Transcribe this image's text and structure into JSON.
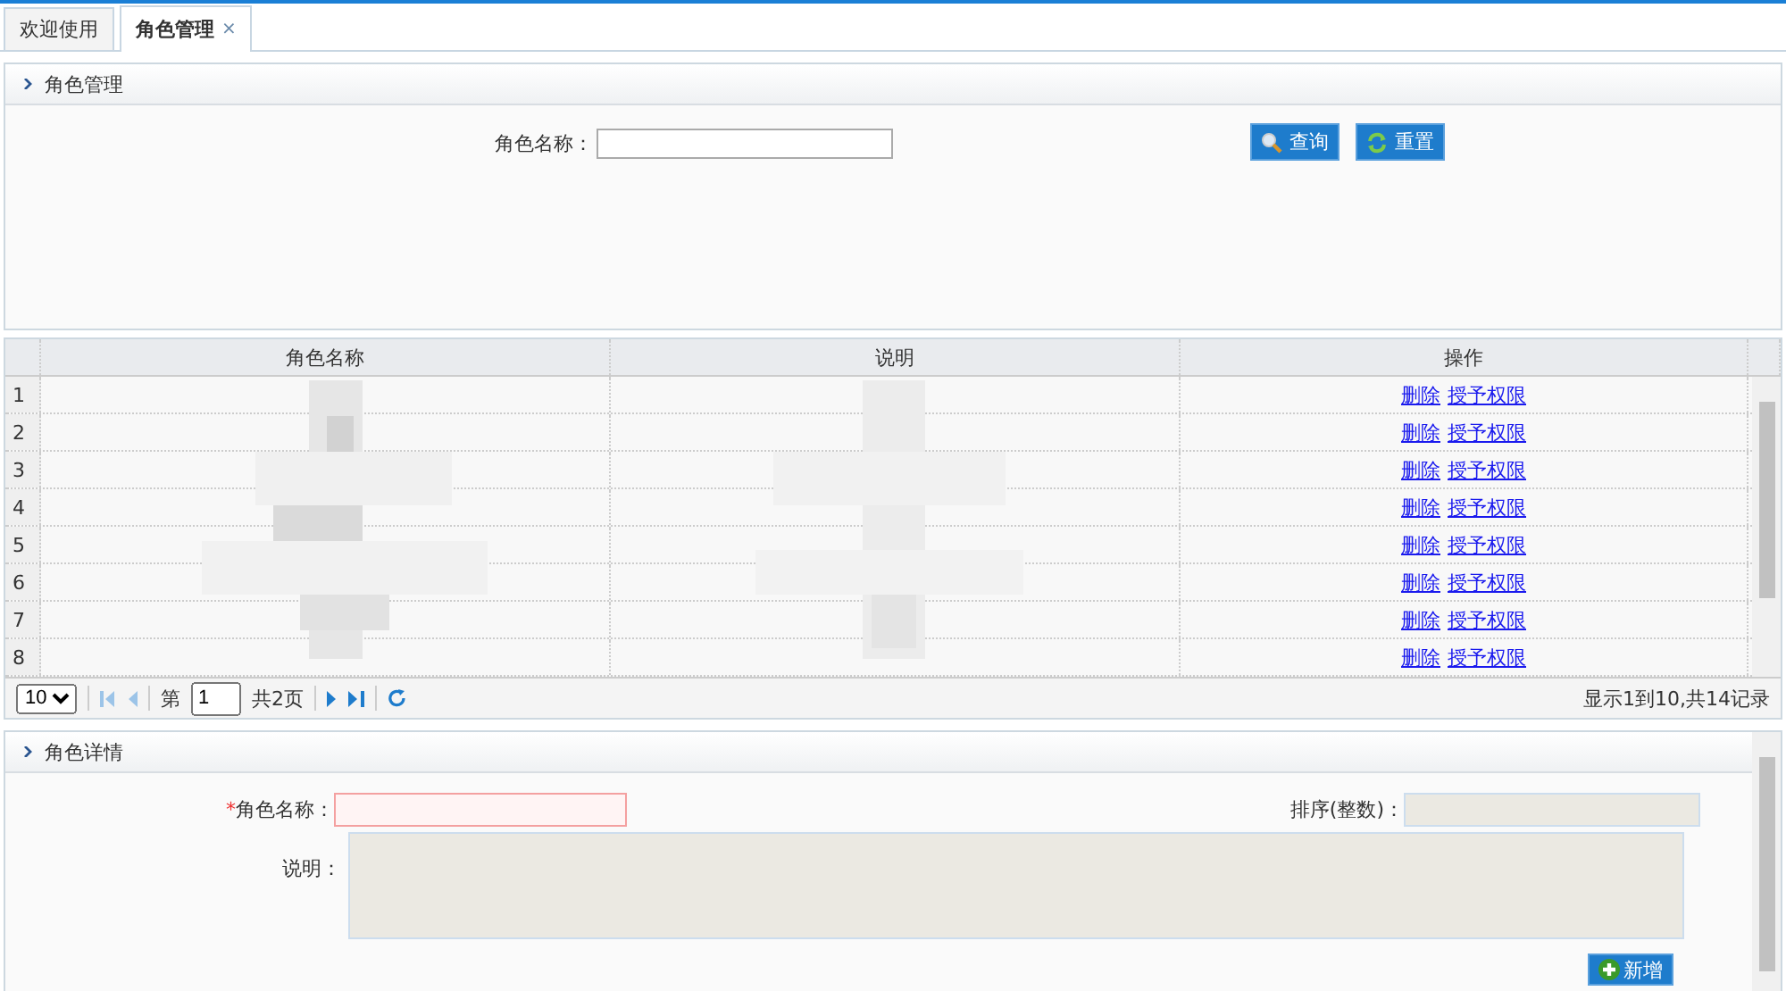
{
  "tabs": [
    {
      "label": "欢迎使用",
      "selected": false
    },
    {
      "label": "角色管理",
      "selected": true,
      "close": "×"
    }
  ],
  "search_panel": {
    "title": "角色管理",
    "field_label": "角色名称：",
    "buttons": [
      {
        "kind": "search",
        "label": "查询"
      },
      {
        "kind": "reset",
        "label": "重置"
      }
    ]
  },
  "grid": {
    "columns": [
      "角色名称",
      "说明",
      "操作"
    ],
    "rows": [
      {
        "num": "1",
        "actions": [
          "删除",
          "授予权限"
        ]
      },
      {
        "num": "2",
        "actions": [
          "删除",
          "授予权限"
        ]
      },
      {
        "num": "3",
        "actions": [
          "删除",
          "授予权限"
        ]
      },
      {
        "num": "4",
        "actions": [
          "删除",
          "授予权限"
        ]
      },
      {
        "num": "5",
        "actions": [
          "删除",
          "授予权限"
        ]
      },
      {
        "num": "6",
        "actions": [
          "删除",
          "授予权限"
        ]
      },
      {
        "num": "7",
        "actions": [
          "删除",
          "授予权限"
        ]
      },
      {
        "num": "8",
        "actions": [
          "删除",
          "授予权限"
        ]
      }
    ],
    "pager": {
      "page_size": "10",
      "page_prefix": "第",
      "page": "1",
      "page_total": "共2页",
      "summary": "显示1到10,共14记录"
    }
  },
  "detail_panel": {
    "title": "角色详情",
    "name_required": "*",
    "name_label": "角色名称：",
    "order_label": "排序(整数)：",
    "desc_label": "说明：",
    "add_button": "新增"
  }
}
